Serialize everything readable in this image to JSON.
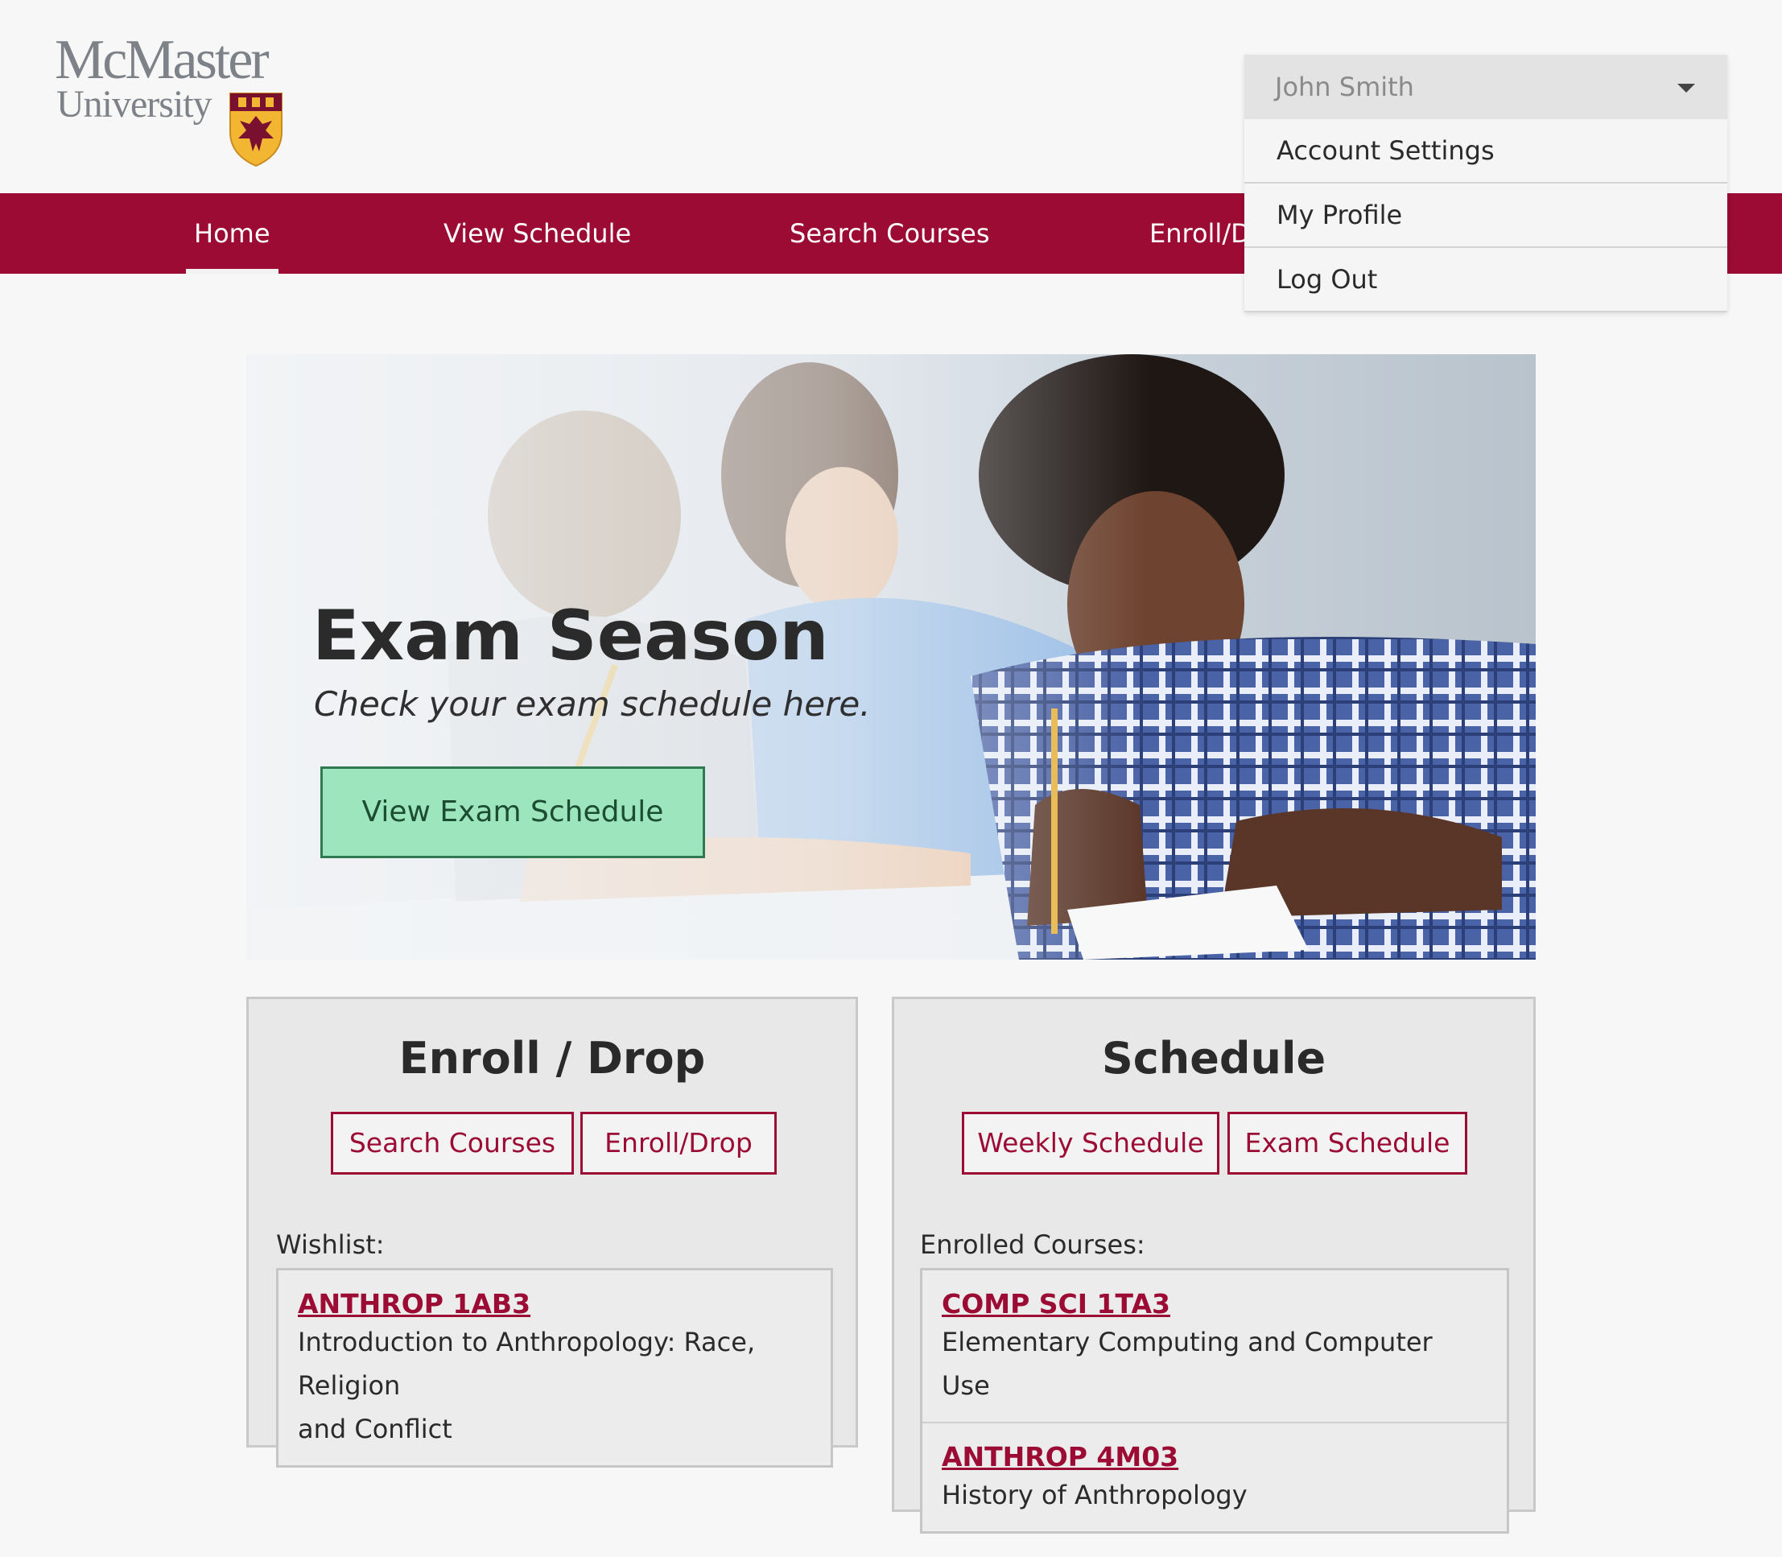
{
  "brand": {
    "logo_line1": "McMaster",
    "logo_line2": "University",
    "primary_color": "#9b0b33",
    "accent_green": "#9de6bd"
  },
  "nav": {
    "items": [
      {
        "label": "Home",
        "active": true
      },
      {
        "label": "View Schedule",
        "active": false
      },
      {
        "label": "Search Courses",
        "active": false
      },
      {
        "label": "Enroll/Drop",
        "active": false
      }
    ]
  },
  "user_menu": {
    "user_name": "John Smith",
    "items": [
      {
        "label": "Account Settings"
      },
      {
        "label": "My Profile"
      },
      {
        "label": "Log Out"
      }
    ]
  },
  "hero": {
    "title": "Exam Season",
    "subtitle": "Check your exam schedule here.",
    "button_label": "View Exam Schedule"
  },
  "enroll_card": {
    "title": "Enroll / Drop",
    "buttons": [
      {
        "label": "Search Courses"
      },
      {
        "label": "Enroll/Drop"
      }
    ],
    "list_label": "Wishlist:",
    "courses": [
      {
        "code": "ANTHROP 1AB3",
        "name_line1": "Introduction to Anthropology: Race, Religion",
        "name_line2": "and Conflict"
      }
    ]
  },
  "schedule_card": {
    "title": "Schedule",
    "buttons": [
      {
        "label": "Weekly Schedule"
      },
      {
        "label": "Exam Schedule"
      }
    ],
    "list_label": "Enrolled Courses:",
    "courses": [
      {
        "code": "COMP SCI 1TA3",
        "name": "Elementary Computing and Computer Use"
      },
      {
        "code": "ANTHROP 4M03",
        "name": "History of Anthropology"
      }
    ]
  }
}
